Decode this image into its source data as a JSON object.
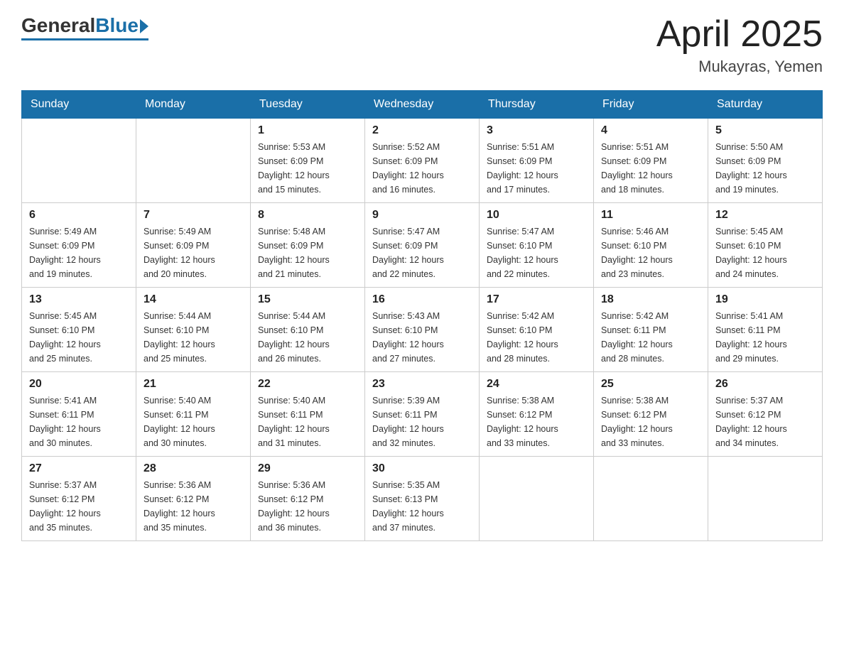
{
  "header": {
    "logo": {
      "general": "General",
      "blue": "Blue"
    },
    "title": "April 2025",
    "location": "Mukayras, Yemen"
  },
  "weekdays": [
    "Sunday",
    "Monday",
    "Tuesday",
    "Wednesday",
    "Thursday",
    "Friday",
    "Saturday"
  ],
  "weeks": [
    [
      {
        "day": "",
        "info": ""
      },
      {
        "day": "",
        "info": ""
      },
      {
        "day": "1",
        "info": "Sunrise: 5:53 AM\nSunset: 6:09 PM\nDaylight: 12 hours\nand 15 minutes."
      },
      {
        "day": "2",
        "info": "Sunrise: 5:52 AM\nSunset: 6:09 PM\nDaylight: 12 hours\nand 16 minutes."
      },
      {
        "day": "3",
        "info": "Sunrise: 5:51 AM\nSunset: 6:09 PM\nDaylight: 12 hours\nand 17 minutes."
      },
      {
        "day": "4",
        "info": "Sunrise: 5:51 AM\nSunset: 6:09 PM\nDaylight: 12 hours\nand 18 minutes."
      },
      {
        "day": "5",
        "info": "Sunrise: 5:50 AM\nSunset: 6:09 PM\nDaylight: 12 hours\nand 19 minutes."
      }
    ],
    [
      {
        "day": "6",
        "info": "Sunrise: 5:49 AM\nSunset: 6:09 PM\nDaylight: 12 hours\nand 19 minutes."
      },
      {
        "day": "7",
        "info": "Sunrise: 5:49 AM\nSunset: 6:09 PM\nDaylight: 12 hours\nand 20 minutes."
      },
      {
        "day": "8",
        "info": "Sunrise: 5:48 AM\nSunset: 6:09 PM\nDaylight: 12 hours\nand 21 minutes."
      },
      {
        "day": "9",
        "info": "Sunrise: 5:47 AM\nSunset: 6:09 PM\nDaylight: 12 hours\nand 22 minutes."
      },
      {
        "day": "10",
        "info": "Sunrise: 5:47 AM\nSunset: 6:10 PM\nDaylight: 12 hours\nand 22 minutes."
      },
      {
        "day": "11",
        "info": "Sunrise: 5:46 AM\nSunset: 6:10 PM\nDaylight: 12 hours\nand 23 minutes."
      },
      {
        "day": "12",
        "info": "Sunrise: 5:45 AM\nSunset: 6:10 PM\nDaylight: 12 hours\nand 24 minutes."
      }
    ],
    [
      {
        "day": "13",
        "info": "Sunrise: 5:45 AM\nSunset: 6:10 PM\nDaylight: 12 hours\nand 25 minutes."
      },
      {
        "day": "14",
        "info": "Sunrise: 5:44 AM\nSunset: 6:10 PM\nDaylight: 12 hours\nand 25 minutes."
      },
      {
        "day": "15",
        "info": "Sunrise: 5:44 AM\nSunset: 6:10 PM\nDaylight: 12 hours\nand 26 minutes."
      },
      {
        "day": "16",
        "info": "Sunrise: 5:43 AM\nSunset: 6:10 PM\nDaylight: 12 hours\nand 27 minutes."
      },
      {
        "day": "17",
        "info": "Sunrise: 5:42 AM\nSunset: 6:10 PM\nDaylight: 12 hours\nand 28 minutes."
      },
      {
        "day": "18",
        "info": "Sunrise: 5:42 AM\nSunset: 6:11 PM\nDaylight: 12 hours\nand 28 minutes."
      },
      {
        "day": "19",
        "info": "Sunrise: 5:41 AM\nSunset: 6:11 PM\nDaylight: 12 hours\nand 29 minutes."
      }
    ],
    [
      {
        "day": "20",
        "info": "Sunrise: 5:41 AM\nSunset: 6:11 PM\nDaylight: 12 hours\nand 30 minutes."
      },
      {
        "day": "21",
        "info": "Sunrise: 5:40 AM\nSunset: 6:11 PM\nDaylight: 12 hours\nand 30 minutes."
      },
      {
        "day": "22",
        "info": "Sunrise: 5:40 AM\nSunset: 6:11 PM\nDaylight: 12 hours\nand 31 minutes."
      },
      {
        "day": "23",
        "info": "Sunrise: 5:39 AM\nSunset: 6:11 PM\nDaylight: 12 hours\nand 32 minutes."
      },
      {
        "day": "24",
        "info": "Sunrise: 5:38 AM\nSunset: 6:12 PM\nDaylight: 12 hours\nand 33 minutes."
      },
      {
        "day": "25",
        "info": "Sunrise: 5:38 AM\nSunset: 6:12 PM\nDaylight: 12 hours\nand 33 minutes."
      },
      {
        "day": "26",
        "info": "Sunrise: 5:37 AM\nSunset: 6:12 PM\nDaylight: 12 hours\nand 34 minutes."
      }
    ],
    [
      {
        "day": "27",
        "info": "Sunrise: 5:37 AM\nSunset: 6:12 PM\nDaylight: 12 hours\nand 35 minutes."
      },
      {
        "day": "28",
        "info": "Sunrise: 5:36 AM\nSunset: 6:12 PM\nDaylight: 12 hours\nand 35 minutes."
      },
      {
        "day": "29",
        "info": "Sunrise: 5:36 AM\nSunset: 6:12 PM\nDaylight: 12 hours\nand 36 minutes."
      },
      {
        "day": "30",
        "info": "Sunrise: 5:35 AM\nSunset: 6:13 PM\nDaylight: 12 hours\nand 37 minutes."
      },
      {
        "day": "",
        "info": ""
      },
      {
        "day": "",
        "info": ""
      },
      {
        "day": "",
        "info": ""
      }
    ]
  ]
}
